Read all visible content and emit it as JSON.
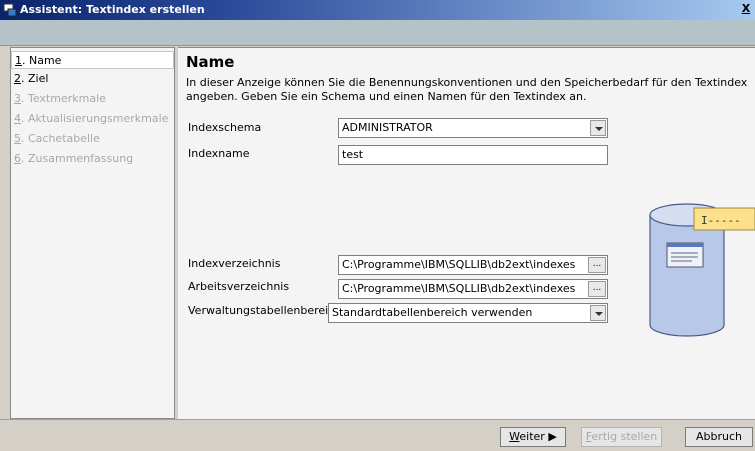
{
  "window": {
    "title": "Assistent: Textindex erstellen",
    "close_label": "X"
  },
  "nav": {
    "items": [
      {
        "num": "1",
        "label": ". Name",
        "state": "selected"
      },
      {
        "num": "2",
        "label": ". Ziel",
        "state": "enabled"
      },
      {
        "num": "3",
        "label": ". Textmerkmale",
        "state": "disabled"
      },
      {
        "num": "4",
        "label": ". Aktualisierungsmerkmale",
        "state": "disabled"
      },
      {
        "num": "5",
        "label": ". Cachetabelle",
        "state": "disabled"
      },
      {
        "num": "6",
        "label": ". Zusammenfassung",
        "state": "disabled"
      }
    ]
  },
  "main": {
    "heading": "Name",
    "description": "In dieser Anzeige können Sie die Benennungskonventionen und den Speicherbedarf für den Textindex angeben. Geben Sie ein Schema und einen Namen für den Textindex an.",
    "index_schema": {
      "label": "Indexschema",
      "value": "ADMINISTRATOR"
    },
    "index_name": {
      "label": "Indexname",
      "value": "test"
    },
    "index_directory": {
      "label": "Indexverzeichnis",
      "value": "C:\\Programme\\IBM\\SQLLIB\\db2ext\\indexes",
      "browse_label": "..."
    },
    "work_directory": {
      "label": "Arbeitsverzeichnis",
      "value": "C:\\Programme\\IBM\\SQLLIB\\db2ext\\indexes",
      "browse_label": "..."
    },
    "admin_tablespace": {
      "label": "Verwaltungstabellenbereich",
      "value": "Standardtabellenbereich verwenden"
    },
    "illustration": {
      "icon": "database-text-index-icon",
      "label_glyph": "I-----"
    }
  },
  "buttons": {
    "next": {
      "mnemonic": "W",
      "rest": "eiter",
      "arrow": "▶"
    },
    "finish": {
      "mnemonic": "F",
      "rest": "ertig stellen"
    },
    "cancel": {
      "label": "Abbruch"
    }
  },
  "colors": {
    "title_start": "#0a246a",
    "title_end": "#a6caf0",
    "band": "#b5c2c8",
    "panel": "#f4f4f4",
    "disabled_text": "#a8a8a8",
    "cylinder": "#b8c8e8",
    "note": "#fce08c"
  }
}
